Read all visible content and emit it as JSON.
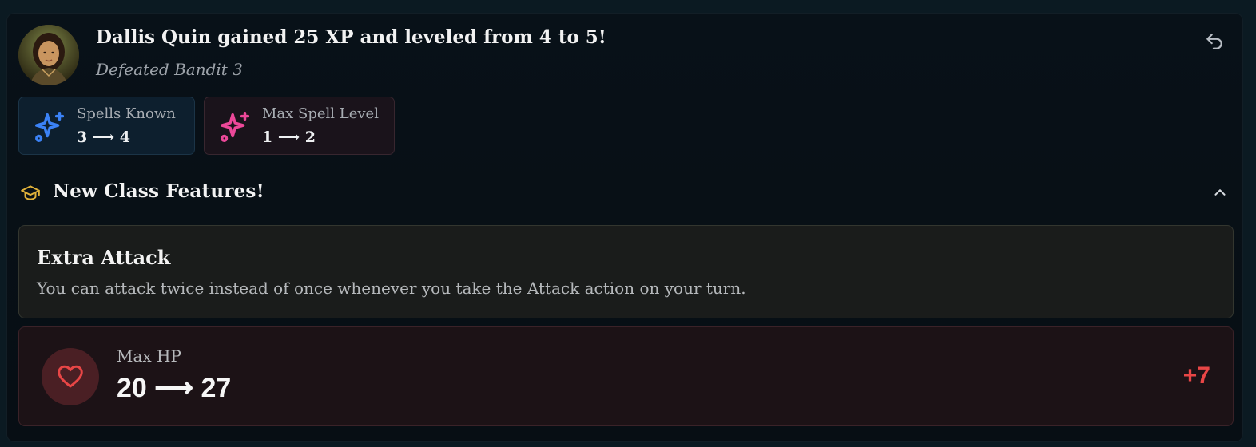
{
  "event": {
    "headline": "Dallis Quin gained 25 XP and leveled from 4 to 5!",
    "subline": "Defeated Bandit 3"
  },
  "stats": [
    {
      "label": "Spells Known",
      "value": "3 ⟶ 4",
      "icon": "sparkles-icon",
      "color": "#3b82f6"
    },
    {
      "label": "Max Spell Level",
      "value": "1 ⟶ 2",
      "icon": "sparkles-icon",
      "color": "#ec4899"
    }
  ],
  "features": {
    "title": "New Class Features!",
    "items": [
      {
        "name": "Extra Attack",
        "description": "You can attack twice instead of once whenever you take the Attack action on your turn."
      }
    ]
  },
  "hp": {
    "label": "Max HP",
    "value": "20 ⟶ 27",
    "delta": "+7",
    "color": "#e84646"
  }
}
